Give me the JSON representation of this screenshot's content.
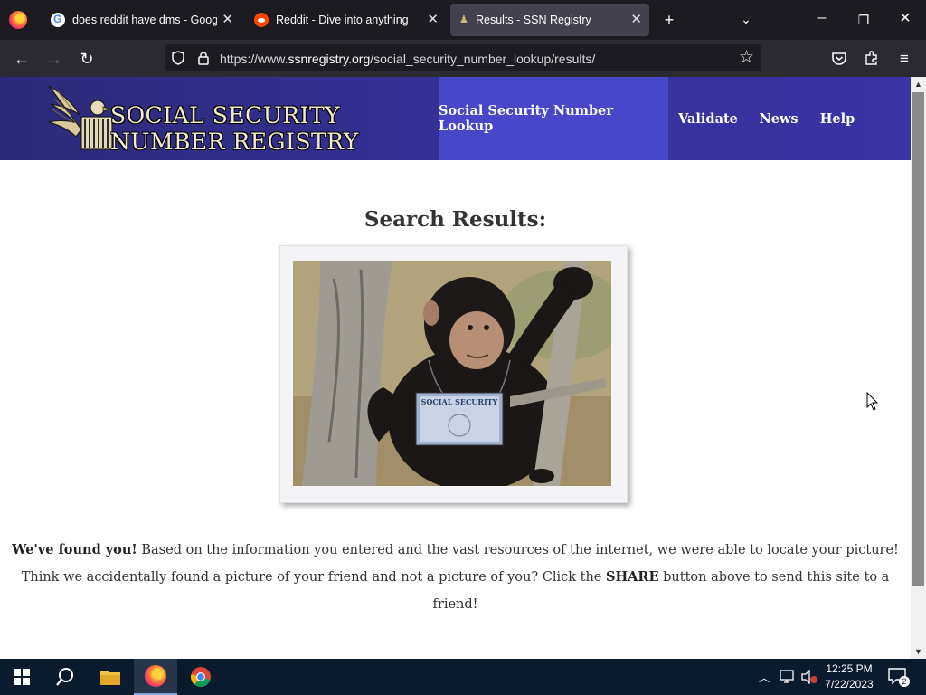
{
  "browser": {
    "tabs": [
      {
        "title": "does reddit have dms - Google",
        "favicon": "google-icon",
        "active": false
      },
      {
        "title": "Reddit - Dive into anything",
        "favicon": "reddit-icon",
        "active": false
      },
      {
        "title": "Results - SSN Registry",
        "favicon": "ssn-icon",
        "active": true
      }
    ],
    "url_prefix": "https://www.",
    "url_domain": "ssnregistry.org",
    "url_path": "/social_security_number_lookup/results/"
  },
  "site": {
    "logo_line1": "SOCIAL SECURITY",
    "logo_line2": "NUMBER REGISTRY",
    "nav": [
      {
        "label": "Social Security Number Lookup",
        "active": true
      },
      {
        "label": "Validate",
        "active": false
      },
      {
        "label": "News",
        "active": false
      },
      {
        "label": "Help",
        "active": false
      }
    ],
    "card_text": "SOCIAL SECURITY"
  },
  "results": {
    "title": "Search Results:",
    "line1_bold": "We've found you!",
    "line1_rest": " Based on the information you entered and the vast resources of the internet, we were able to locate your picture!",
    "line2_pre": "Think we accidentally found a picture of your friend and not a picture of you? Click the ",
    "line2_bold": "SHARE",
    "line2_post": " button above to send this site to a friend!"
  },
  "taskbar": {
    "time": "12:25 PM",
    "date": "7/22/2023",
    "notification_count": "2"
  },
  "colors": {
    "header_bg": "#343094",
    "nav_active_bg": "#4847c9",
    "browser_bg": "#1c1b22",
    "taskbar_bg": "#0b1b2e"
  }
}
